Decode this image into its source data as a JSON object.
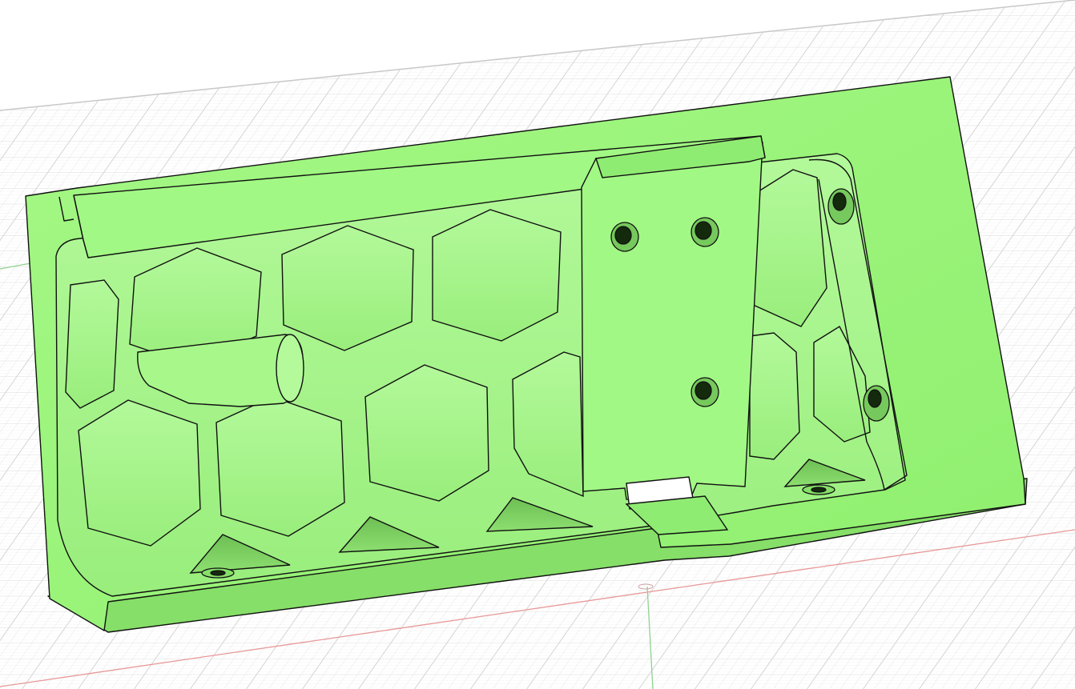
{
  "viewport": {
    "background": "#ffffff",
    "grid_color": "#d8d8d8",
    "grid_minor_color": "#e9e9e9",
    "x_axis_color": "#e88888",
    "y_axis_color": "#8fd28f"
  },
  "model": {
    "body_color": "#9bf57c",
    "body_shade_color": "#86df68",
    "pocket_color": "#a8f78b",
    "pocket_wall_color": "#74c85a",
    "edge_color": "#111111",
    "hexagonal_pocket_count": 13,
    "through_hole_count": 3,
    "counterbore_hole_count": 2,
    "countersunk_hole_count": 2,
    "peg_count": 1
  }
}
